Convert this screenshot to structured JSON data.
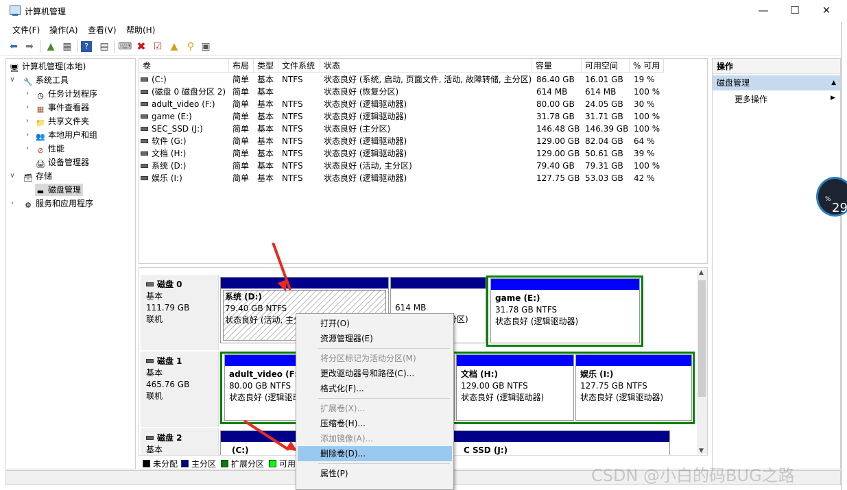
{
  "title": "计算机管理",
  "menu": [
    "文件(F)",
    "操作(A)",
    "查看(V)",
    "帮助(H)"
  ],
  "tree": {
    "root": "计算机管理(本地)",
    "system_tools": "系统工具",
    "task_scheduler": "任务计划程序",
    "event_viewer": "事件查看器",
    "shared_folders": "共享文件夹",
    "local_users": "本地用户和组",
    "performance": "性能",
    "device_manager": "设备管理器",
    "storage": "存储",
    "disk_management": "磁盘管理",
    "services": "服务和应用程序"
  },
  "columns": [
    "卷",
    "布局",
    "类型",
    "文件系统",
    "状态",
    "容量",
    "可用空间",
    "% 可用"
  ],
  "volumes": [
    {
      "name": "(C:)",
      "layout": "简单",
      "type": "基本",
      "fs": "NTFS",
      "status": "状态良好 (系统, 启动, 页面文件, 活动, 故障转储, 主分区)",
      "cap": "86.40 GB",
      "free": "16.01 GB",
      "pct": "19 %"
    },
    {
      "name": "(磁盘 0 磁盘分区 2)",
      "layout": "简单",
      "type": "基本",
      "fs": "",
      "status": "状态良好 (恢复分区)",
      "cap": "614 MB",
      "free": "614 MB",
      "pct": "100 %"
    },
    {
      "name": "adult_video (F:)",
      "layout": "简单",
      "type": "基本",
      "fs": "NTFS",
      "status": "状态良好 (逻辑驱动器)",
      "cap": "80.00 GB",
      "free": "24.05 GB",
      "pct": "30 %"
    },
    {
      "name": "game (E:)",
      "layout": "简单",
      "type": "基本",
      "fs": "NTFS",
      "status": "状态良好 (逻辑驱动器)",
      "cap": "31.78 GB",
      "free": "31.71 GB",
      "pct": "100 %"
    },
    {
      "name": "SEC_SSD (J:)",
      "layout": "简单",
      "type": "基本",
      "fs": "NTFS",
      "status": "状态良好 (主分区)",
      "cap": "146.48 GB",
      "free": "146.39 GB",
      "pct": "100 %"
    },
    {
      "name": "软件 (G:)",
      "layout": "简单",
      "type": "基本",
      "fs": "NTFS",
      "status": "状态良好 (逻辑驱动器)",
      "cap": "129.00 GB",
      "free": "82.04 GB",
      "pct": "64 %"
    },
    {
      "name": "文档 (H:)",
      "layout": "简单",
      "type": "基本",
      "fs": "NTFS",
      "status": "状态良好 (逻辑驱动器)",
      "cap": "129.00 GB",
      "free": "50.61 GB",
      "pct": "39 %"
    },
    {
      "name": "系统 (D:)",
      "layout": "简单",
      "type": "基本",
      "fs": "NTFS",
      "status": "状态良好 (活动, 主分区)",
      "cap": "79.40 GB",
      "free": "79.31 GB",
      "pct": "100 %"
    },
    {
      "name": "娱乐 (I:)",
      "layout": "简单",
      "type": "基本",
      "fs": "NTFS",
      "status": "状态良好 (逻辑驱动器)",
      "cap": "127.75 GB",
      "free": "53.03 GB",
      "pct": "42 %"
    }
  ],
  "disks": {
    "d0": {
      "name": "磁盘 0",
      "type": "基本",
      "size": "111.79 GB",
      "state": "联机"
    },
    "d1": {
      "name": "磁盘 1",
      "type": "基本",
      "size": "465.76 GB",
      "state": "联机"
    },
    "d2": {
      "name": "磁盘 2",
      "type": "基本"
    }
  },
  "parts": {
    "d_name": "系统 (D:)",
    "d_size": "79.40 GB NTFS",
    "d_status": "状态良好 (活动, 主分",
    "rec_size": "614 MB",
    "rec_status": "分区)",
    "e_name": "game (E:)",
    "e_size": "31.78 GB NTFS",
    "e_status": "状态良好 (逻辑驱动器)",
    "f_name": "adult_video (F:)",
    "f_size": "80.00 GB NTFS",
    "f_status": "状态良好 (逻辑驱动",
    "h_name": "文档 (H:)",
    "h_size": "129.00 GB NTFS",
    "h_status": "状态良好 (逻辑驱动器)",
    "i_name": "娱乐 (I:)",
    "i_size": "127.75 GB NTFS",
    "i_status": "状态良好 (逻辑驱动器)",
    "c_name": "(C:)",
    "j_name": "C SSD (J:)"
  },
  "legend": [
    "未分配",
    "主分区",
    "扩展分区",
    "可用"
  ],
  "actions": {
    "header": "操作",
    "section": "磁盘管理",
    "more": "更多操作"
  },
  "context_menu": [
    "打开(O)",
    "资源管理器(E)",
    "将分区标记为活动分区(M)",
    "更改驱动器号和路径(C)...",
    "格式化(F)...",
    "扩展卷(X)...",
    "压缩卷(H)...",
    "添加镜像(A)...",
    "删除卷(D)...",
    "属性(P)"
  ],
  "gauge": {
    "value": "29",
    "unit": "%"
  },
  "watermark": "CSDN @小白的码BUG之路",
  "colors": {
    "primary": "#00008b",
    "logical": "#0000ff",
    "extended": "#008000",
    "free": "#00ff00",
    "unallocated": "#000000",
    "highlight": "#99c9ef"
  }
}
